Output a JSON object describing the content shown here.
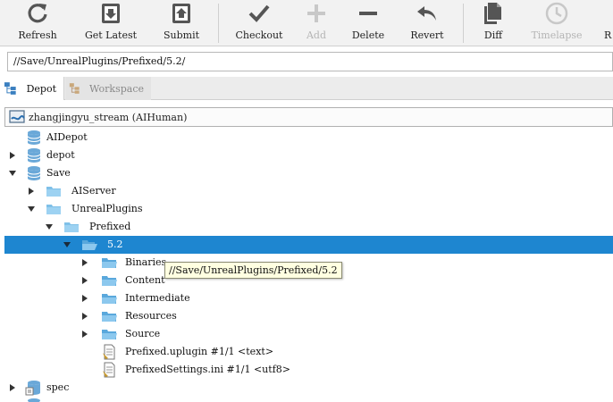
{
  "toolbar": {
    "buttons": [
      {
        "label": "Refresh",
        "icon": "refresh-icon",
        "enabled": true
      },
      {
        "label": "Get Latest",
        "icon": "get-latest-icon",
        "enabled": true
      },
      {
        "label": "Submit",
        "icon": "submit-icon",
        "enabled": true
      },
      {
        "label": "Checkout",
        "icon": "checkmark-icon",
        "enabled": true
      },
      {
        "label": "Add",
        "icon": "plus-icon",
        "enabled": false
      },
      {
        "label": "Delete",
        "icon": "minus-icon",
        "enabled": true
      },
      {
        "label": "Revert",
        "icon": "revert-arrow-icon",
        "enabled": true
      },
      {
        "label": "Diff",
        "icon": "diff-documents-icon",
        "enabled": true
      },
      {
        "label": "Timelapse",
        "icon": "clock-icon",
        "enabled": false
      },
      {
        "label": "R",
        "icon": "",
        "enabled": true
      }
    ]
  },
  "path_bar": {
    "value": "//Save/UnrealPlugins/Prefixed/5.2/"
  },
  "tabs": [
    {
      "label": "Depot",
      "icon": "depot-tree-icon",
      "active": true
    },
    {
      "label": "Workspace",
      "icon": "workspace-tree-icon",
      "active": false
    }
  ],
  "workspace": {
    "label": "zhangjingyu_stream (AIHuman)",
    "icon": "stream-workspace-icon"
  },
  "tree": [
    {
      "label": "AIDepot",
      "type": "depot"
    },
    {
      "label": "depot",
      "type": "depot"
    },
    {
      "label": "Save",
      "type": "depot"
    },
    {
      "label": "AIServer",
      "type": "folder"
    },
    {
      "label": "UnrealPlugins",
      "type": "folder"
    },
    {
      "label": "Prefixed",
      "type": "folder"
    },
    {
      "label": "5.2",
      "type": "folder",
      "selected": true
    },
    {
      "label": "Binaries",
      "type": "folder"
    },
    {
      "label": "Content",
      "type": "folder"
    },
    {
      "label": "Intermediate",
      "type": "folder"
    },
    {
      "label": "Resources",
      "type": "folder"
    },
    {
      "label": "Source",
      "type": "folder"
    },
    {
      "label": "Prefixed.uplugin #1/1 <text>",
      "type": "file"
    },
    {
      "label": "PrefixedSettings.ini #1/1 <utf8>",
      "type": "file"
    },
    {
      "label": "spec",
      "type": "depot"
    }
  ],
  "tooltip": {
    "text": "//Save/UnrealPlugins/Prefixed/5.2"
  },
  "colors": {
    "selection": "#1e86d0",
    "folder": "#7fc0e8",
    "depot": "#6aa8d8",
    "tooltip_bg": "#ffffe1"
  }
}
